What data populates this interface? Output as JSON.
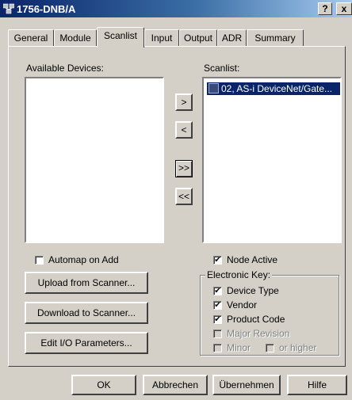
{
  "window": {
    "title": "1756-DNB/A",
    "help_button": "?",
    "close_button": "x"
  },
  "tabs": [
    {
      "label": "General"
    },
    {
      "label": "Module"
    },
    {
      "label": "Scanlist"
    },
    {
      "label": "Input"
    },
    {
      "label": "Output"
    },
    {
      "label": "ADR"
    },
    {
      "label": "Summary"
    }
  ],
  "scanlist_tab": {
    "available_label": "Available Devices:",
    "scanlist_label": "Scanlist:",
    "scanlist_items": [
      "02, AS-i DeviceNet/Gate..."
    ],
    "move_buttons": {
      "add": ">",
      "remove": "<",
      "add_all": ">>",
      "remove_all": "<<"
    },
    "automap": {
      "label": "Automap on Add",
      "checked": false
    },
    "node_active": {
      "label": "Node Active",
      "checked": true
    },
    "electronic_key": {
      "legend": "Electronic Key:",
      "device_type": "Device Type",
      "vendor": "Vendor",
      "product_code": "Product Code",
      "major_revision": "Major Revision",
      "minor": "Minor",
      "or_higher": "or higher"
    },
    "buttons": {
      "upload": "Upload from Scanner...",
      "download": "Download to Scanner...",
      "edit_io": "Edit I/O Parameters..."
    }
  },
  "footer": {
    "ok": "OK",
    "cancel": "Abbrechen",
    "apply": "Übernehmen",
    "help": "Hilfe"
  },
  "check_glyph": "✔"
}
